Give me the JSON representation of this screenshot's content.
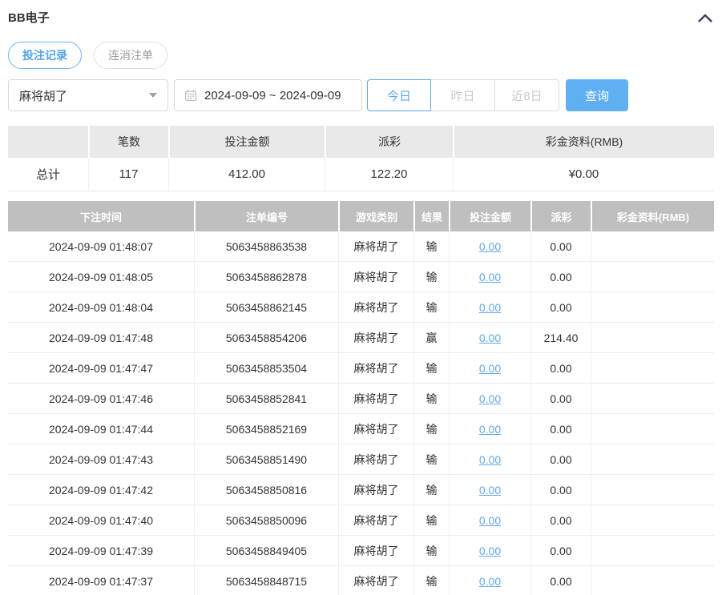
{
  "page": {
    "title": "BB电子"
  },
  "tabs": [
    {
      "label": "投注记录",
      "active": true
    },
    {
      "label": "连消注单",
      "active": false
    }
  ],
  "filters": {
    "game_type": {
      "value": "麻将胡了"
    },
    "date_range": {
      "value": "2024-09-09 ~ 2024-09-09"
    },
    "quick_ranges": [
      {
        "label": "今日",
        "active": true
      },
      {
        "label": "昨日",
        "active": false
      },
      {
        "label": "近8日",
        "active": false
      }
    ],
    "query_button": "查询"
  },
  "summary": {
    "headers": [
      "",
      "笔数",
      "投注金额",
      "派彩",
      "彩金资料(RMB)"
    ],
    "total": {
      "label": "总计",
      "count": "117",
      "bet_amount": "412.00",
      "payout": "122.20",
      "bonus": "¥0.00"
    }
  },
  "table": {
    "headers": [
      "下注时间",
      "注单编号",
      "游戏类别",
      "结果",
      "投注金额",
      "派彩",
      "彩金资料(RMB)"
    ],
    "rows": [
      {
        "time": "2024-09-09 01:48:07",
        "order": "5063458863538",
        "game": "麻将胡了",
        "result": "输",
        "bet": "0.00",
        "payout": "0.00",
        "bonus": ""
      },
      {
        "time": "2024-09-09 01:48:05",
        "order": "5063458862878",
        "game": "麻将胡了",
        "result": "输",
        "bet": "0.00",
        "payout": "0.00",
        "bonus": ""
      },
      {
        "time": "2024-09-09 01:48:04",
        "order": "5063458862145",
        "game": "麻将胡了",
        "result": "输",
        "bet": "0.00",
        "payout": "0.00",
        "bonus": ""
      },
      {
        "time": "2024-09-09 01:47:48",
        "order": "5063458854206",
        "game": "麻将胡了",
        "result": "赢",
        "bet": "0.00",
        "payout": "214.40",
        "bonus": ""
      },
      {
        "time": "2024-09-09 01:47:47",
        "order": "5063458853504",
        "game": "麻将胡了",
        "result": "输",
        "bet": "0.00",
        "payout": "0.00",
        "bonus": ""
      },
      {
        "time": "2024-09-09 01:47:46",
        "order": "5063458852841",
        "game": "麻将胡了",
        "result": "输",
        "bet": "0.00",
        "payout": "0.00",
        "bonus": ""
      },
      {
        "time": "2024-09-09 01:47:44",
        "order": "5063458852169",
        "game": "麻将胡了",
        "result": "输",
        "bet": "0.00",
        "payout": "0.00",
        "bonus": ""
      },
      {
        "time": "2024-09-09 01:47:43",
        "order": "5063458851490",
        "game": "麻将胡了",
        "result": "输",
        "bet": "0.00",
        "payout": "0.00",
        "bonus": ""
      },
      {
        "time": "2024-09-09 01:47:42",
        "order": "5063458850816",
        "game": "麻将胡了",
        "result": "输",
        "bet": "0.00",
        "payout": "0.00",
        "bonus": ""
      },
      {
        "time": "2024-09-09 01:47:40",
        "order": "5063458850096",
        "game": "麻将胡了",
        "result": "输",
        "bet": "0.00",
        "payout": "0.00",
        "bonus": ""
      },
      {
        "time": "2024-09-09 01:47:39",
        "order": "5063458849405",
        "game": "麻将胡了",
        "result": "输",
        "bet": "0.00",
        "payout": "0.00",
        "bonus": ""
      },
      {
        "time": "2024-09-09 01:47:37",
        "order": "5063458848715",
        "game": "麻将胡了",
        "result": "输",
        "bet": "0.00",
        "payout": "0.00",
        "bonus": ""
      }
    ]
  },
  "colors": {
    "accent_blue": "#5aaaf0",
    "query_button_blue": "#5fb0f2",
    "link_blue": "#5fa8e8",
    "table_header_gray": "#bfbfbf",
    "summary_header_gray": "#e9e9e9"
  }
}
